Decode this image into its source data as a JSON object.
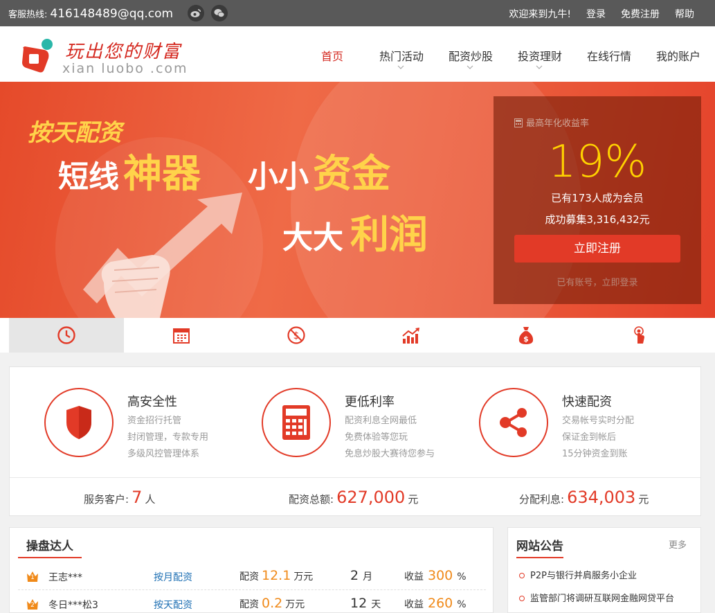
{
  "topbar": {
    "hotline_label": "客服热线:",
    "hotline_value": "416148489@qq.com",
    "social": [
      "weibo-icon",
      "wechat-icon"
    ],
    "links": [
      "欢迎来到九牛!",
      "登录",
      "免费注册",
      "帮助"
    ]
  },
  "header": {
    "slogan": "玩出您的财富",
    "domain": "xian luobo .com",
    "nav": [
      {
        "label": "首页",
        "active": true,
        "dropdown": false
      },
      {
        "label": "热门活动",
        "active": false,
        "dropdown": true
      },
      {
        "label": "配资炒股",
        "active": false,
        "dropdown": true
      },
      {
        "label": "投资理财",
        "active": false,
        "dropdown": true
      },
      {
        "label": "在线行情",
        "active": false,
        "dropdown": false
      },
      {
        "label": "我的账户",
        "active": false,
        "dropdown": false
      }
    ]
  },
  "banner": {
    "line1": "按天配资",
    "line2a": "短线",
    "line2b": "神器",
    "line3a": "小小",
    "line3b": "资金",
    "line4a": "大大",
    "line4b": "利润",
    "panel": {
      "header": "最高年化收益率",
      "rate": "19%",
      "members": "已有173人成为会员",
      "raised": "成功募集3,316,432元",
      "register_button": "立即注册",
      "login_link": "已有账号，立即登录"
    }
  },
  "tabs": [
    "clock-icon",
    "calendar-icon",
    "dollar-icon",
    "chart-icon",
    "money-bag-icon",
    "touch-icon"
  ],
  "features": [
    {
      "title": "高安全性",
      "lines": [
        "资金招行托管",
        "封闭管理，专款专用",
        "多级风控管理体系"
      ],
      "icon": "shield-icon"
    },
    {
      "title": "更低利率",
      "lines": [
        "配资利息全网最低",
        "免费体验等您玩",
        "免息炒股大赛待您参与"
      ],
      "icon": "calculator-icon"
    },
    {
      "title": "快速配资",
      "lines": [
        "交易帐号实时分配",
        "保证金到帐后",
        "15分钟资金到账"
      ],
      "icon": "share-icon"
    }
  ],
  "stats": [
    {
      "label": "服务客户:",
      "value": "7",
      "unit": "人"
    },
    {
      "label": "配资总额:",
      "value": "627,000",
      "unit": "元"
    },
    {
      "label": "分配利息:",
      "value": "634,003",
      "unit": "元"
    }
  ],
  "experts": {
    "title": "操盘达人",
    "rows": [
      {
        "rank": "1",
        "name": "王志***",
        "type": "按月配资",
        "amt_label": "配资",
        "amt": "12.1",
        "amt_unit": "万元",
        "dur": "2",
        "dur_unit": "月",
        "prof_label": "收益",
        "prof": "300",
        "prof_unit": "%"
      },
      {
        "rank": "2",
        "name": "冬日***松3",
        "type": "按天配资",
        "amt_label": "配资",
        "amt": "0.2",
        "amt_unit": "万元",
        "dur": "12",
        "dur_unit": "天",
        "prof_label": "收益",
        "prof": "260",
        "prof_unit": "%"
      }
    ]
  },
  "notices": {
    "title": "网站公告",
    "more": "更多",
    "items": [
      "P2P与银行并肩服务小企业",
      "监管部门将调研互联网金融网贷平台"
    ]
  },
  "colors": {
    "accent": "#e23a27",
    "gold": "#ffd200",
    "orange": "#f08a1a",
    "link": "#1d6fb3"
  }
}
